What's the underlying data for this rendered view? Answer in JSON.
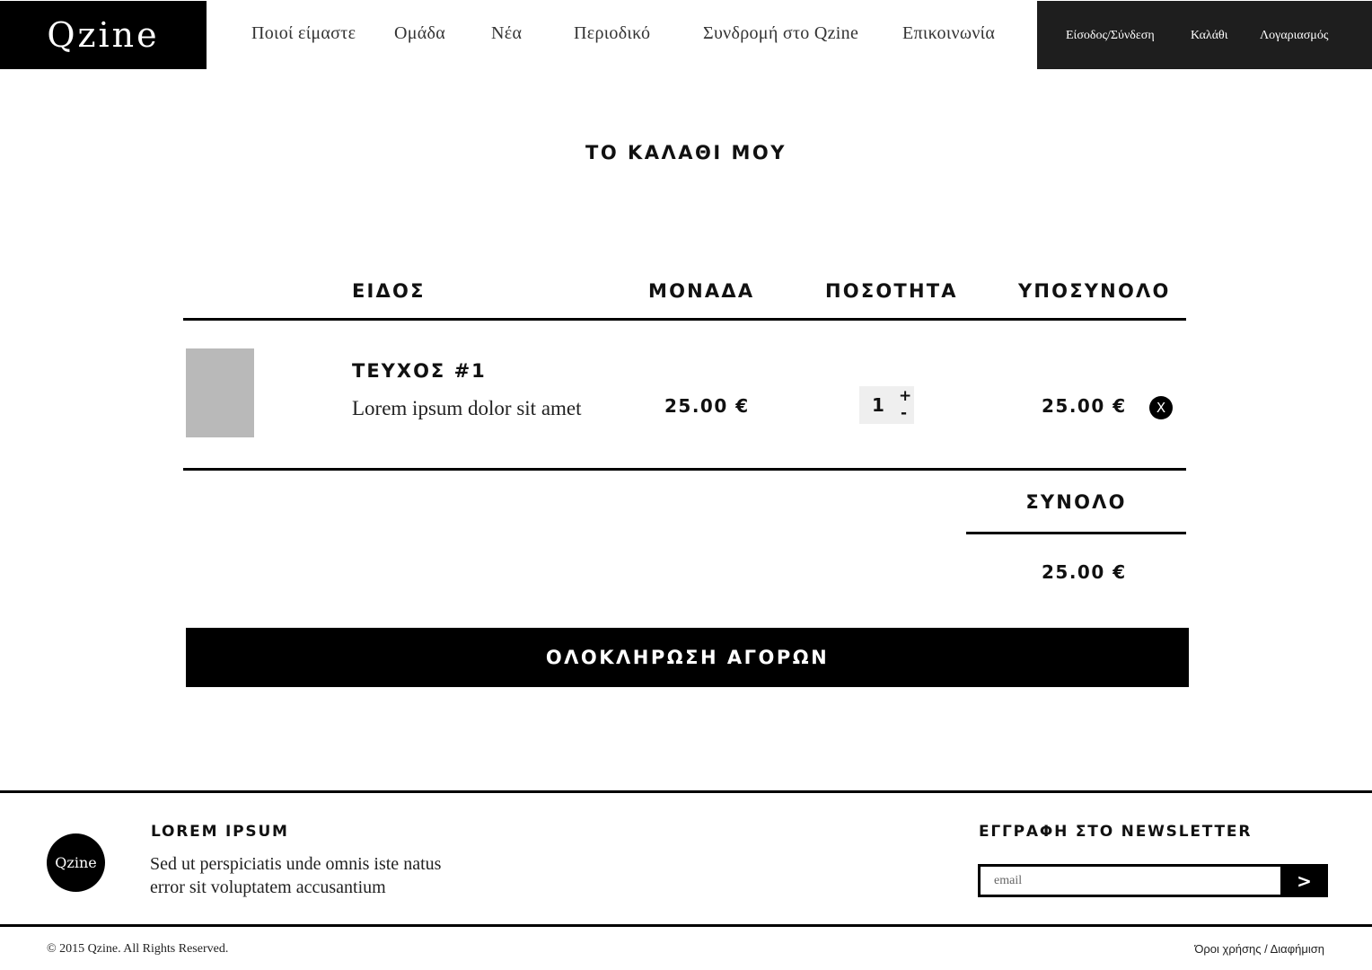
{
  "brand": {
    "name": "Qzine"
  },
  "nav": {
    "items": [
      {
        "label": "Ποιοί είμαστε"
      },
      {
        "label": "Ομάδα"
      },
      {
        "label": "Νέα"
      },
      {
        "label": "Περιοδικό"
      },
      {
        "label": "Συνδρομή στο Qzine"
      },
      {
        "label": "Επικοινωνία"
      }
    ]
  },
  "account": {
    "login": "Είσοδος/Σύνδεση",
    "cart": "Καλάθι",
    "account": "Λογαριασμός"
  },
  "cart": {
    "title": "ΤΟ ΚΑΛΑΘΙ ΜΟΥ",
    "columns": {
      "item": "ΕΙΔΟΣ",
      "unit": "ΜΟΝΑΔΑ",
      "quantity": "ΠΟΣΟΤΗΤΑ",
      "subtotal": "ΥΠΟΣΥΝΟΛΟ"
    },
    "items": [
      {
        "title": "ΤΕΥΧΟΣ #1",
        "description": "Lorem ipsum dolor sit amet",
        "unit_price": "25.00 €",
        "quantity": "1",
        "plus": "+",
        "minus": "-",
        "subtotal": "25.00 €",
        "remove": "X"
      }
    ],
    "total_label": "ΣΥΝΟΛΟ",
    "total_value": "25.00 €",
    "checkout": "ΟΛΟΚΛΗΡΩΣΗ ΑΓΟΡΩΝ"
  },
  "footer": {
    "logo": "Qzine",
    "about_title": "LOREM IPSUM",
    "about_line1": "Sed ut perspiciatis unde omnis iste natus",
    "about_line2": "error sit voluptatem accusantium",
    "newsletter_title": "ΕΓΓΡΑΦΗ ΣΤΟ NEWSLETTER",
    "email_placeholder": "email",
    "submit": ">",
    "copyright": "© 2015 Qzine. All Rights Reserved.",
    "terms": "Όροι χρήσης",
    "separator": " / ",
    "advertising": "Διαφήμιση"
  }
}
